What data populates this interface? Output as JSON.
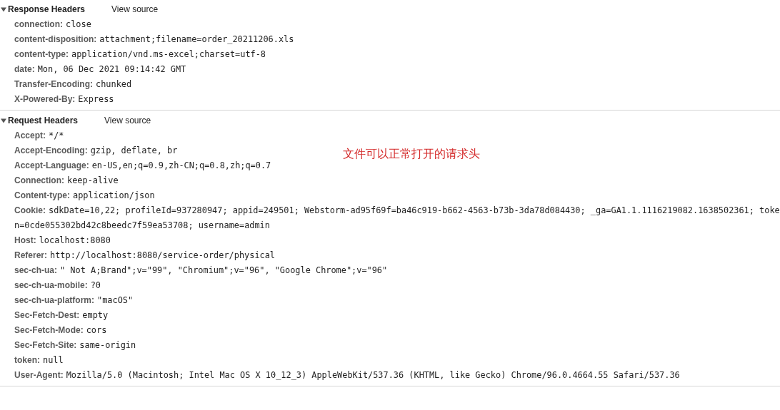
{
  "sections": [
    {
      "title": "Response Headers",
      "expanded": true,
      "link": "View source",
      "headers": [
        {
          "name": "connection:",
          "value": "close"
        },
        {
          "name": "content-disposition:",
          "value": "attachment;filename=order_20211206.xls"
        },
        {
          "name": "content-type:",
          "value": "application/vnd.ms-excel;charset=utf-8"
        },
        {
          "name": "date:",
          "value": "Mon, 06 Dec 2021 09:14:42 GMT"
        },
        {
          "name": "Transfer-Encoding:",
          "value": "chunked"
        },
        {
          "name": "X-Powered-By:",
          "value": "Express"
        }
      ]
    },
    {
      "title": "Request Headers",
      "expanded": true,
      "link": "View source",
      "headers": [
        {
          "name": "Accept:",
          "value": "*/*"
        },
        {
          "name": "Accept-Encoding:",
          "value": "gzip, deflate, br"
        },
        {
          "name": "Accept-Language:",
          "value": "en-US,en;q=0.9,zh-CN;q=0.8,zh;q=0.7"
        },
        {
          "name": "Connection:",
          "value": "keep-alive"
        },
        {
          "name": "Content-type:",
          "value": "application/json"
        },
        {
          "name": "Cookie:",
          "value": "sdkDate=10,22; profileId=937280947; appid=249501; Webstorm-ad95f69f=ba46c919-b662-4563-b73b-3da78d084430; _ga=GA1.1.1116219082.1638502361; token=0cde055302bd42c8beedc7f59ea53708; username=admin"
        },
        {
          "name": "Host:",
          "value": "localhost:8080"
        },
        {
          "name": "Referer:",
          "value": "http://localhost:8080/service-order/physical"
        },
        {
          "name": "sec-ch-ua:",
          "value": "\" Not A;Brand\";v=\"99\", \"Chromium\";v=\"96\", \"Google Chrome\";v=\"96\""
        },
        {
          "name": "sec-ch-ua-mobile:",
          "value": "?0"
        },
        {
          "name": "sec-ch-ua-platform:",
          "value": "\"macOS\""
        },
        {
          "name": "Sec-Fetch-Dest:",
          "value": "empty"
        },
        {
          "name": "Sec-Fetch-Mode:",
          "value": "cors"
        },
        {
          "name": "Sec-Fetch-Site:",
          "value": "same-origin"
        },
        {
          "name": "token:",
          "value": "null"
        },
        {
          "name": "User-Agent:",
          "value": "Mozilla/5.0 (Macintosh; Intel Mac OS X 10_12_3) AppleWebKit/537.36 (KHTML, like Gecko) Chrome/96.0.4664.55 Safari/537.36"
        }
      ]
    }
  ],
  "annotation": "文件可以正常打开的请求头"
}
